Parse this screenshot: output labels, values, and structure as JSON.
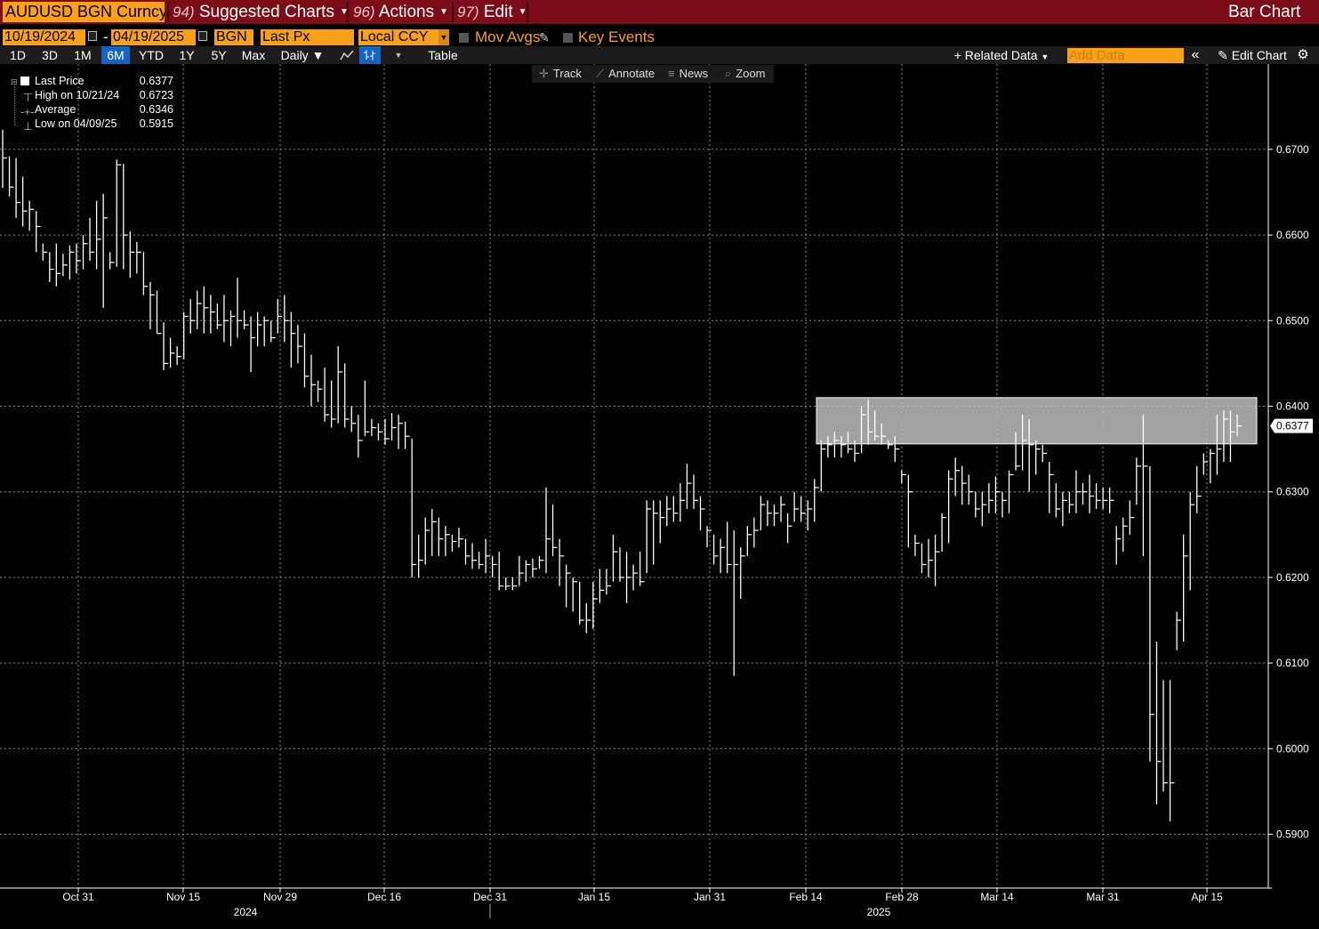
{
  "topbar": {
    "security": "AUDUSD BGN Curncy",
    "menus": [
      {
        "num": "94)",
        "label": "Suggested Charts"
      },
      {
        "num": "96)",
        "label": "Actions"
      },
      {
        "num": "97)",
        "label": "Edit"
      }
    ],
    "title": "Bar Chart"
  },
  "controls": {
    "start_date": "10/19/2024",
    "dash": "-",
    "end_date": "04/19/2025",
    "source": "BGN",
    "field": "Last Px",
    "currency": "Local CCY",
    "mov_avgs": "Mov Avgs",
    "key_events": "Key Events"
  },
  "range_bar": {
    "ranges": [
      "1D",
      "3D",
      "1M",
      "6M",
      "YTD",
      "1Y",
      "5Y",
      "Max"
    ],
    "active_range": "6M",
    "frequency": "Daily",
    "table": "Table",
    "related_data": "Related Data",
    "add_data_placeholder": "Add Data",
    "edit_chart": "Edit Chart"
  },
  "tools": [
    "Track",
    "Annotate",
    "News",
    "Zoom"
  ],
  "legend": [
    {
      "label": "Last Price",
      "value": "0.6377"
    },
    {
      "label": "High on 10/21/24",
      "value": "0.6723"
    },
    {
      "label": "Average",
      "value": "0.6346"
    },
    {
      "label": "Low on 04/09/25",
      "value": "0.5915"
    }
  ],
  "colors": {
    "topbar": "#7d0c19",
    "orange_field": "#f9a01b",
    "active_range": "#1565c0",
    "background": "#000000",
    "bars": "#ffffff",
    "highlight_box": "#bdbdbd"
  },
  "chart_data": {
    "type": "ohlc-bar",
    "y_ticks": [
      "0.5900",
      "0.6000",
      "0.6100",
      "0.6200",
      "0.6300",
      "0.6400",
      "0.6500",
      "0.6600",
      "0.6700"
    ],
    "ylim": [
      0.5854,
      0.6802
    ],
    "x_tick_labels": [
      "Oct 31",
      "Nov 15",
      "Nov 29",
      "Dec 16",
      "Dec 31",
      "Jan 15",
      "Jan 31",
      "Feb 14",
      "Feb 28",
      "Mar 14",
      "Mar 31",
      "Apr 15"
    ],
    "year_labels": [
      "2024",
      "2025"
    ],
    "last_price_label": "0.6377",
    "highlight_band": [
      0.6356,
      0.641
    ],
    "grid": true,
    "bars": [
      {
        "high": 0.6723,
        "low": 0.6655,
        "close": 0.669
      },
      {
        "high": 0.6692,
        "low": 0.6645,
        "close": 0.6656
      },
      {
        "high": 0.669,
        "low": 0.662,
        "close": 0.6638
      },
      {
        "high": 0.6668,
        "low": 0.661,
        "close": 0.6628
      },
      {
        "high": 0.664,
        "low": 0.6605,
        "close": 0.663
      },
      {
        "high": 0.6628,
        "low": 0.658,
        "close": 0.661
      },
      {
        "high": 0.659,
        "low": 0.657,
        "close": 0.658
      },
      {
        "high": 0.658,
        "low": 0.6545,
        "close": 0.656
      },
      {
        "high": 0.659,
        "low": 0.654,
        "close": 0.6555
      },
      {
        "high": 0.6578,
        "low": 0.6552,
        "close": 0.6565
      },
      {
        "high": 0.6588,
        "low": 0.6548,
        "close": 0.658
      },
      {
        "high": 0.659,
        "low": 0.6555,
        "close": 0.657
      },
      {
        "high": 0.66,
        "low": 0.656,
        "close": 0.659
      },
      {
        "high": 0.662,
        "low": 0.657,
        "close": 0.658
      },
      {
        "high": 0.664,
        "low": 0.656,
        "close": 0.6595
      },
      {
        "high": 0.6648,
        "low": 0.6515,
        "close": 0.662
      },
      {
        "high": 0.658,
        "low": 0.656,
        "close": 0.6568
      },
      {
        "high": 0.6688,
        "low": 0.6563,
        "close": 0.6682
      },
      {
        "high": 0.6683,
        "low": 0.656,
        "close": 0.66
      },
      {
        "high": 0.6604,
        "low": 0.655,
        "close": 0.658
      },
      {
        "high": 0.6592,
        "low": 0.6555,
        "close": 0.658
      },
      {
        "high": 0.658,
        "low": 0.653,
        "close": 0.654
      },
      {
        "high": 0.6545,
        "low": 0.649,
        "close": 0.653
      },
      {
        "high": 0.6535,
        "low": 0.6485,
        "close": 0.6485
      },
      {
        "high": 0.6498,
        "low": 0.6442,
        "close": 0.645
      },
      {
        "high": 0.648,
        "low": 0.6445,
        "close": 0.6462
      },
      {
        "high": 0.647,
        "low": 0.6448,
        "close": 0.6458
      },
      {
        "high": 0.651,
        "low": 0.6455,
        "close": 0.6505
      },
      {
        "high": 0.6525,
        "low": 0.6485,
        "close": 0.65
      },
      {
        "high": 0.6535,
        "low": 0.649,
        "close": 0.652
      },
      {
        "high": 0.654,
        "low": 0.6485,
        "close": 0.6515
      },
      {
        "high": 0.653,
        "low": 0.6485,
        "close": 0.651
      },
      {
        "high": 0.652,
        "low": 0.649,
        "close": 0.6495
      },
      {
        "high": 0.653,
        "low": 0.6475,
        "close": 0.65
      },
      {
        "high": 0.6512,
        "low": 0.647,
        "close": 0.6505
      },
      {
        "high": 0.655,
        "low": 0.648,
        "close": 0.65
      },
      {
        "high": 0.6512,
        "low": 0.649,
        "close": 0.6495
      },
      {
        "high": 0.6505,
        "low": 0.644,
        "close": 0.648
      },
      {
        "high": 0.651,
        "low": 0.647,
        "close": 0.6495
      },
      {
        "high": 0.6505,
        "low": 0.647,
        "close": 0.65
      },
      {
        "high": 0.65,
        "low": 0.6475,
        "close": 0.648
      },
      {
        "high": 0.6525,
        "low": 0.6485,
        "close": 0.6505
      },
      {
        "high": 0.653,
        "low": 0.6475,
        "close": 0.65
      },
      {
        "high": 0.651,
        "low": 0.6445,
        "close": 0.6485
      },
      {
        "high": 0.6495,
        "low": 0.645,
        "close": 0.647
      },
      {
        "high": 0.6485,
        "low": 0.6422,
        "close": 0.6435
      },
      {
        "high": 0.646,
        "low": 0.64,
        "close": 0.6425
      },
      {
        "high": 0.643,
        "low": 0.6405,
        "close": 0.642
      },
      {
        "high": 0.6445,
        "low": 0.6382,
        "close": 0.639
      },
      {
        "high": 0.643,
        "low": 0.6375,
        "close": 0.6385
      },
      {
        "high": 0.647,
        "low": 0.638,
        "close": 0.644
      },
      {
        "high": 0.645,
        "low": 0.6375,
        "close": 0.6385
      },
      {
        "high": 0.64,
        "low": 0.637,
        "close": 0.638
      },
      {
        "high": 0.639,
        "low": 0.634,
        "close": 0.636
      },
      {
        "high": 0.643,
        "low": 0.6365,
        "close": 0.637
      },
      {
        "high": 0.6385,
        "low": 0.6365,
        "close": 0.6375
      },
      {
        "high": 0.638,
        "low": 0.636,
        "close": 0.637
      },
      {
        "high": 0.6385,
        "low": 0.6355,
        "close": 0.6362
      },
      {
        "high": 0.6392,
        "low": 0.636,
        "close": 0.6375
      },
      {
        "high": 0.639,
        "low": 0.635,
        "close": 0.638
      },
      {
        "high": 0.6382,
        "low": 0.635,
        "close": 0.6365
      },
      {
        "high": 0.6362,
        "low": 0.62,
        "close": 0.6215
      },
      {
        "high": 0.625,
        "low": 0.62,
        "close": 0.622
      },
      {
        "high": 0.627,
        "low": 0.6215,
        "close": 0.6255
      },
      {
        "high": 0.628,
        "low": 0.6225,
        "close": 0.6265
      },
      {
        "high": 0.627,
        "low": 0.6225,
        "close": 0.6245
      },
      {
        "high": 0.626,
        "low": 0.6225,
        "close": 0.625
      },
      {
        "high": 0.625,
        "low": 0.623,
        "close": 0.6242
      },
      {
        "high": 0.6258,
        "low": 0.6235,
        "close": 0.6245
      },
      {
        "high": 0.6245,
        "low": 0.6215,
        "close": 0.6225
      },
      {
        "high": 0.624,
        "low": 0.621,
        "close": 0.622
      },
      {
        "high": 0.623,
        "low": 0.621,
        "close": 0.6215
      },
      {
        "high": 0.6245,
        "low": 0.6205,
        "close": 0.6225
      },
      {
        "high": 0.6225,
        "low": 0.62,
        "close": 0.6215
      },
      {
        "high": 0.623,
        "low": 0.6185,
        "close": 0.619
      },
      {
        "high": 0.62,
        "low": 0.6185,
        "close": 0.619
      },
      {
        "high": 0.62,
        "low": 0.6185,
        "close": 0.619
      },
      {
        "high": 0.6225,
        "low": 0.619,
        "close": 0.6205
      },
      {
        "high": 0.622,
        "low": 0.6195,
        "close": 0.6215
      },
      {
        "high": 0.6222,
        "low": 0.62,
        "close": 0.621
      },
      {
        "high": 0.6225,
        "low": 0.621,
        "close": 0.622
      },
      {
        "high": 0.6305,
        "low": 0.6205,
        "close": 0.6245
      },
      {
        "high": 0.6285,
        "low": 0.6225,
        "close": 0.6235
      },
      {
        "high": 0.6245,
        "low": 0.619,
        "close": 0.6225
      },
      {
        "high": 0.6215,
        "low": 0.6165,
        "close": 0.6205
      },
      {
        "high": 0.62,
        "low": 0.616,
        "close": 0.6195
      },
      {
        "high": 0.6195,
        "low": 0.6145,
        "close": 0.615
      },
      {
        "high": 0.617,
        "low": 0.6135,
        "close": 0.615
      },
      {
        "high": 0.6195,
        "low": 0.614,
        "close": 0.6175
      },
      {
        "high": 0.621,
        "low": 0.617,
        "close": 0.6185
      },
      {
        "high": 0.621,
        "low": 0.618,
        "close": 0.619
      },
      {
        "high": 0.625,
        "low": 0.6195,
        "close": 0.623
      },
      {
        "high": 0.6235,
        "low": 0.6195,
        "close": 0.62
      },
      {
        "high": 0.623,
        "low": 0.617,
        "close": 0.62
      },
      {
        "high": 0.6215,
        "low": 0.6185,
        "close": 0.6205
      },
      {
        "high": 0.623,
        "low": 0.619,
        "close": 0.6195
      },
      {
        "high": 0.629,
        "low": 0.6205,
        "close": 0.628
      },
      {
        "high": 0.629,
        "low": 0.6215,
        "close": 0.6275
      },
      {
        "high": 0.629,
        "low": 0.624,
        "close": 0.627
      },
      {
        "high": 0.6295,
        "low": 0.626,
        "close": 0.628
      },
      {
        "high": 0.6295,
        "low": 0.6265,
        "close": 0.6275
      },
      {
        "high": 0.631,
        "low": 0.6265,
        "close": 0.629
      },
      {
        "high": 0.6333,
        "low": 0.628,
        "close": 0.631
      },
      {
        "high": 0.632,
        "low": 0.628,
        "close": 0.629
      },
      {
        "high": 0.6295,
        "low": 0.6255,
        "close": 0.628
      },
      {
        "high": 0.626,
        "low": 0.6235,
        "close": 0.6255
      },
      {
        "high": 0.625,
        "low": 0.6215,
        "close": 0.6225
      },
      {
        "high": 0.6245,
        "low": 0.6205,
        "close": 0.6235
      },
      {
        "high": 0.6265,
        "low": 0.6205,
        "close": 0.6215
      },
      {
        "high": 0.6255,
        "low": 0.6085,
        "close": 0.6215
      },
      {
        "high": 0.6235,
        "low": 0.6175,
        "close": 0.6225
      },
      {
        "high": 0.626,
        "low": 0.6225,
        "close": 0.625
      },
      {
        "high": 0.627,
        "low": 0.6235,
        "close": 0.6255
      },
      {
        "high": 0.6295,
        "low": 0.6255,
        "close": 0.6285
      },
      {
        "high": 0.629,
        "low": 0.626,
        "close": 0.6275
      },
      {
        "high": 0.6285,
        "low": 0.626,
        "close": 0.6275
      },
      {
        "high": 0.6295,
        "low": 0.6265,
        "close": 0.6285
      },
      {
        "high": 0.6275,
        "low": 0.624,
        "close": 0.626
      },
      {
        "high": 0.63,
        "low": 0.6265,
        "close": 0.628
      },
      {
        "high": 0.6295,
        "low": 0.6265,
        "close": 0.6275
      },
      {
        "high": 0.629,
        "low": 0.6255,
        "close": 0.628
      },
      {
        "high": 0.6315,
        "low": 0.6265,
        "close": 0.6305
      },
      {
        "high": 0.636,
        "low": 0.63,
        "close": 0.635
      },
      {
        "high": 0.6365,
        "low": 0.634,
        "close": 0.6355
      },
      {
        "high": 0.637,
        "low": 0.634,
        "close": 0.636
      },
      {
        "high": 0.6365,
        "low": 0.634,
        "close": 0.6355
      },
      {
        "high": 0.637,
        "low": 0.6345,
        "close": 0.635
      },
      {
        "high": 0.636,
        "low": 0.6335,
        "close": 0.6345
      },
      {
        "high": 0.64,
        "low": 0.6345,
        "close": 0.639
      },
      {
        "high": 0.6408,
        "low": 0.6355,
        "close": 0.637
      },
      {
        "high": 0.6395,
        "low": 0.636,
        "close": 0.6365
      },
      {
        "high": 0.638,
        "low": 0.6355,
        "close": 0.6365
      },
      {
        "high": 0.636,
        "low": 0.635,
        "close": 0.6355
      },
      {
        "high": 0.6365,
        "low": 0.6335,
        "close": 0.635
      },
      {
        "high": 0.6325,
        "low": 0.631,
        "close": 0.632
      },
      {
        "high": 0.632,
        "low": 0.6235,
        "close": 0.63
      },
      {
        "high": 0.625,
        "low": 0.6225,
        "close": 0.624
      },
      {
        "high": 0.624,
        "low": 0.6205,
        "close": 0.6215
      },
      {
        "high": 0.6245,
        "low": 0.62,
        "close": 0.622
      },
      {
        "high": 0.625,
        "low": 0.619,
        "close": 0.623
      },
      {
        "high": 0.6275,
        "low": 0.623,
        "close": 0.627
      },
      {
        "high": 0.6325,
        "low": 0.624,
        "close": 0.6315
      },
      {
        "high": 0.634,
        "low": 0.6295,
        "close": 0.6325
      },
      {
        "high": 0.633,
        "low": 0.6285,
        "close": 0.631
      },
      {
        "high": 0.632,
        "low": 0.6285,
        "close": 0.63
      },
      {
        "high": 0.63,
        "low": 0.627,
        "close": 0.628
      },
      {
        "high": 0.63,
        "low": 0.626,
        "close": 0.6285
      },
      {
        "high": 0.631,
        "low": 0.6275,
        "close": 0.629
      },
      {
        "high": 0.6318,
        "low": 0.6275,
        "close": 0.63
      },
      {
        "high": 0.63,
        "low": 0.627,
        "close": 0.629
      },
      {
        "high": 0.6325,
        "low": 0.6275,
        "close": 0.632
      },
      {
        "high": 0.637,
        "low": 0.6325,
        "close": 0.633
      },
      {
        "high": 0.639,
        "low": 0.6325,
        "close": 0.636
      },
      {
        "high": 0.6385,
        "low": 0.63,
        "close": 0.6355
      },
      {
        "high": 0.636,
        "low": 0.632,
        "close": 0.635
      },
      {
        "high": 0.6355,
        "low": 0.6335,
        "close": 0.6345
      },
      {
        "high": 0.6335,
        "low": 0.6275,
        "close": 0.632
      },
      {
        "high": 0.631,
        "low": 0.627,
        "close": 0.628
      },
      {
        "high": 0.63,
        "low": 0.626,
        "close": 0.629
      },
      {
        "high": 0.63,
        "low": 0.6275,
        "close": 0.6285
      },
      {
        "high": 0.6325,
        "low": 0.6275,
        "close": 0.63
      },
      {
        "high": 0.631,
        "low": 0.6285,
        "close": 0.63
      },
      {
        "high": 0.632,
        "low": 0.6275,
        "close": 0.6295
      },
      {
        "high": 0.631,
        "low": 0.628,
        "close": 0.629
      },
      {
        "high": 0.6305,
        "low": 0.628,
        "close": 0.629
      },
      {
        "high": 0.6305,
        "low": 0.6275,
        "close": 0.629
      },
      {
        "high": 0.626,
        "low": 0.6215,
        "close": 0.6245
      },
      {
        "high": 0.627,
        "low": 0.623,
        "close": 0.626
      },
      {
        "high": 0.629,
        "low": 0.625,
        "close": 0.627
      },
      {
        "high": 0.634,
        "low": 0.6285,
        "close": 0.633
      },
      {
        "high": 0.639,
        "low": 0.6225,
        "close": 0.633
      },
      {
        "high": 0.633,
        "low": 0.5985,
        "close": 0.604
      },
      {
        "high": 0.6125,
        "low": 0.5935,
        "close": 0.5985
      },
      {
        "high": 0.608,
        "low": 0.595,
        "close": 0.596
      },
      {
        "high": 0.608,
        "low": 0.5915,
        "close": 0.596
      },
      {
        "high": 0.616,
        "low": 0.6115,
        "close": 0.615
      },
      {
        "high": 0.625,
        "low": 0.6125,
        "close": 0.6225
      },
      {
        "high": 0.63,
        "low": 0.6185,
        "close": 0.6285
      },
      {
        "high": 0.633,
        "low": 0.6275,
        "close": 0.6295
      },
      {
        "high": 0.6345,
        "low": 0.632,
        "close": 0.6335
      },
      {
        "high": 0.635,
        "low": 0.631,
        "close": 0.6345
      },
      {
        "high": 0.639,
        "low": 0.632,
        "close": 0.635
      },
      {
        "high": 0.6395,
        "low": 0.6335,
        "close": 0.6385
      },
      {
        "high": 0.6395,
        "low": 0.6335,
        "close": 0.637
      },
      {
        "high": 0.639,
        "low": 0.6365,
        "close": 0.6377
      }
    ]
  }
}
